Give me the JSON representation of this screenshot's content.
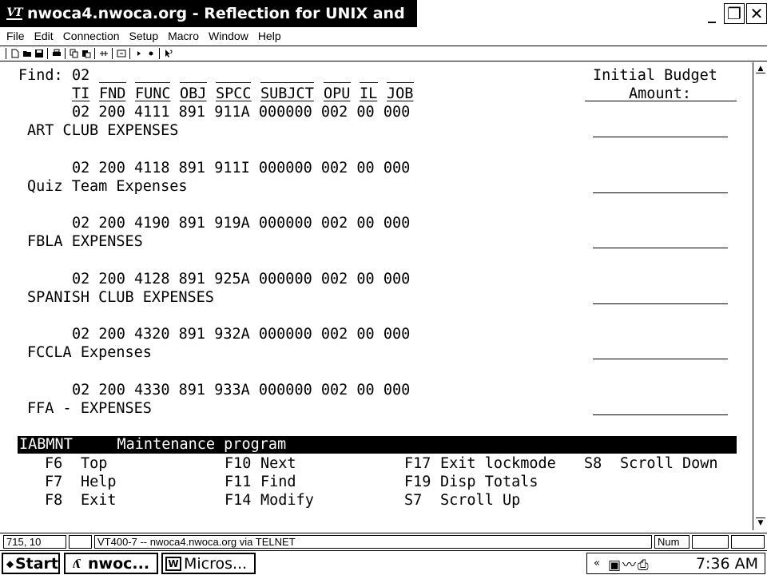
{
  "window": {
    "title": "nwoca4.nwoca.org - Reflection for UNIX and",
    "icon_label": "VT",
    "minimize_glyph": "_",
    "restore_glyph": "❐",
    "close_glyph": "✕"
  },
  "menu": [
    "File",
    "Edit",
    "Connection",
    "Setup",
    "Macro",
    "Window",
    "Help"
  ],
  "terminal": {
    "find_label": "Find:",
    "find_value": "02",
    "budget_header_line1": "Initial Budget",
    "budget_header_line2": "Amount:",
    "columns": [
      "TI",
      "FND",
      "FUNC",
      "OBJ",
      "SPCC",
      "SUBJCT",
      "OPU",
      "IL",
      "JOB"
    ],
    "records": [
      {
        "code": "02 200 4111 891 911A 000000 002 00 000",
        "description": "ART CLUB EXPENSES"
      },
      {
        "code": "02 200 4118 891 911I 000000 002 00 000",
        "description": "Quiz Team Expenses"
      },
      {
        "code": "02 200 4190 891 919A 000000 002 00 000",
        "description": "FBLA EXPENSES"
      },
      {
        "code": "02 200 4128 891 925A 000000 002 00 000",
        "description": "SPANISH CLUB EXPENSES"
      },
      {
        "code": "02 200 4320 891 932A 000000 002 00 000",
        "description": "FCCLA Expenses"
      },
      {
        "code": "02 200 4330 891 933A 000000 002 00 000",
        "description": "FFA - EXPENSES"
      }
    ],
    "program_bar": "IABMNT     Maintenance program",
    "function_keys": [
      {
        "key": "F6",
        "label": "Top"
      },
      {
        "key": "F7",
        "label": "Help"
      },
      {
        "key": "F8",
        "label": "Exit"
      },
      {
        "key": "F10",
        "label": "Next"
      },
      {
        "key": "F11",
        "label": "Find"
      },
      {
        "key": "F14",
        "label": "Modify"
      },
      {
        "key": "F17",
        "label": "Exit lockmode"
      },
      {
        "key": "F19",
        "label": "Disp Totals"
      },
      {
        "key": "S7",
        "label": "Scroll Up"
      },
      {
        "key": "S8",
        "label": "Scroll Down"
      }
    ]
  },
  "status": {
    "cursor": "715, 10",
    "connection": "VT400-7 -- nwoca4.nwoca.org via TELNET",
    "num": "Num"
  },
  "taskbar": {
    "start": "Start",
    "tasks": [
      "nwoc...",
      "Micros..."
    ],
    "tray_chevron": "«",
    "clock": "7:36 AM"
  }
}
